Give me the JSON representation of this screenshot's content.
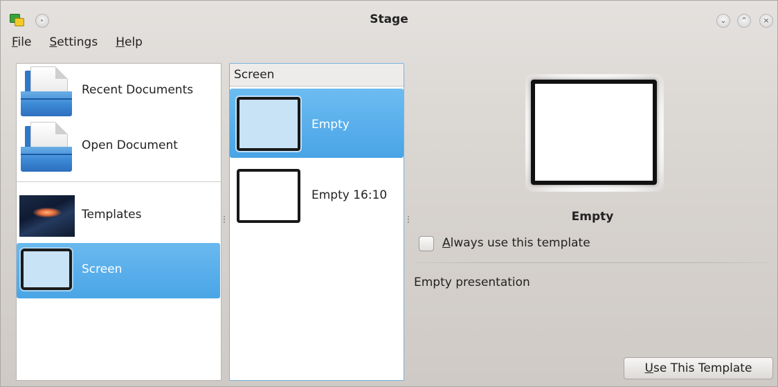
{
  "window": {
    "title": "Stage",
    "controls": {
      "minimize": "⌄",
      "maximize": "⌃",
      "close": "×"
    }
  },
  "menu": {
    "file": {
      "mnemonic": "F",
      "rest": "ile"
    },
    "settings": {
      "mnemonic": "S",
      "rest": "ettings"
    },
    "help": {
      "mnemonic": "H",
      "rest": "elp"
    }
  },
  "categories": [
    {
      "label": "Recent Documents",
      "icon": "folder-document-icon"
    },
    {
      "label": "Open Document",
      "icon": "folder-document-icon"
    },
    {
      "label": "Templates",
      "icon": "templates-thumbnail-icon"
    },
    {
      "label": "Screen",
      "icon": "screen-thumbnail-icon",
      "selected": true
    }
  ],
  "template_list": {
    "header": "Screen",
    "items": [
      {
        "label": "Empty",
        "selected": true
      },
      {
        "label": "Empty 16:10",
        "selected": false
      }
    ]
  },
  "details": {
    "name": "Empty",
    "always_use": {
      "mnemonic": "A",
      "rest": "lways use this template",
      "checked": false
    },
    "description": "Empty presentation",
    "use_button": {
      "mnemonic": "U",
      "rest": "se This Template"
    }
  },
  "colors": {
    "selection": "#4aa5e6",
    "accent_border": "#75b2e2"
  }
}
